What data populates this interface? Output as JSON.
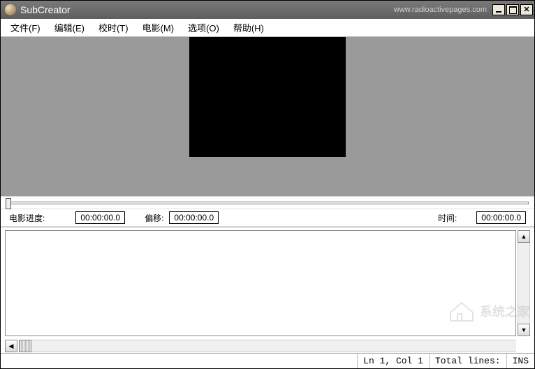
{
  "titlebar": {
    "app_title": "SubCreator",
    "url_text": "www.radioactivepages.com"
  },
  "menu": {
    "file": "文件(F)",
    "edit": "编辑(E)",
    "timing": "校时(T)",
    "movie": "电影(M)",
    "options": "选项(O)",
    "help": "帮助(H)"
  },
  "info": {
    "movie_progress_label": "电影进度:",
    "movie_progress_value": "00:00:00.0",
    "offset_label": "偏移:",
    "offset_value": "00:00:00.0",
    "time_label": "时间:",
    "time_value": "00:00:00.0"
  },
  "status": {
    "ln_col": "Ln 1, Col 1",
    "total_lines": "Total lines:",
    "ins": "INS"
  },
  "watermark": {
    "text": "系统之家"
  }
}
